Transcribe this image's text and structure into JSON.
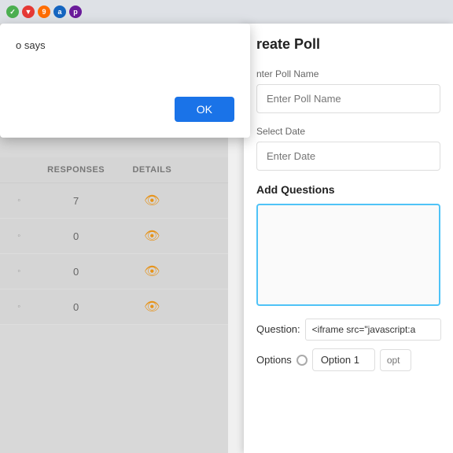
{
  "browser": {
    "icons": [
      {
        "id": "green-icon",
        "symbol": "✓",
        "class": "browser-icon-green"
      },
      {
        "id": "red-icon",
        "symbol": "▼",
        "class": "browser-icon-red"
      },
      {
        "id": "orange-icon",
        "symbol": "9",
        "class": "browser-icon-orange"
      },
      {
        "id": "blue-icon",
        "symbol": "a",
        "class": "browser-icon-blue"
      },
      {
        "id": "purple-icon",
        "symbol": "p",
        "class": "browser-icon-purple"
      }
    ]
  },
  "left_panel": {
    "who_says_label": "o says"
  },
  "table": {
    "columns": [
      "",
      "RESPONSES",
      "DETAILS",
      ""
    ],
    "rows": [
      {
        "responses": "7",
        "has_eye": true
      },
      {
        "responses": "0",
        "has_eye": true
      },
      {
        "responses": "0",
        "has_eye": true
      },
      {
        "responses": "0",
        "has_eye": true
      }
    ]
  },
  "alert_dialog": {
    "message": "o says",
    "ok_label": "OK"
  },
  "create_poll": {
    "title": "reate Poll",
    "poll_name_label": "nter Poll Name",
    "poll_name_placeholder": "Enter Poll Name",
    "date_label": "Select Date",
    "date_placeholder": "Enter Date",
    "add_questions_label": "Add Questions",
    "question_label": "Question:",
    "question_value": "<iframe src=\"javascript:a",
    "options_label": "Options",
    "option1_value": "Option 1",
    "option2_placeholder": "opt"
  }
}
